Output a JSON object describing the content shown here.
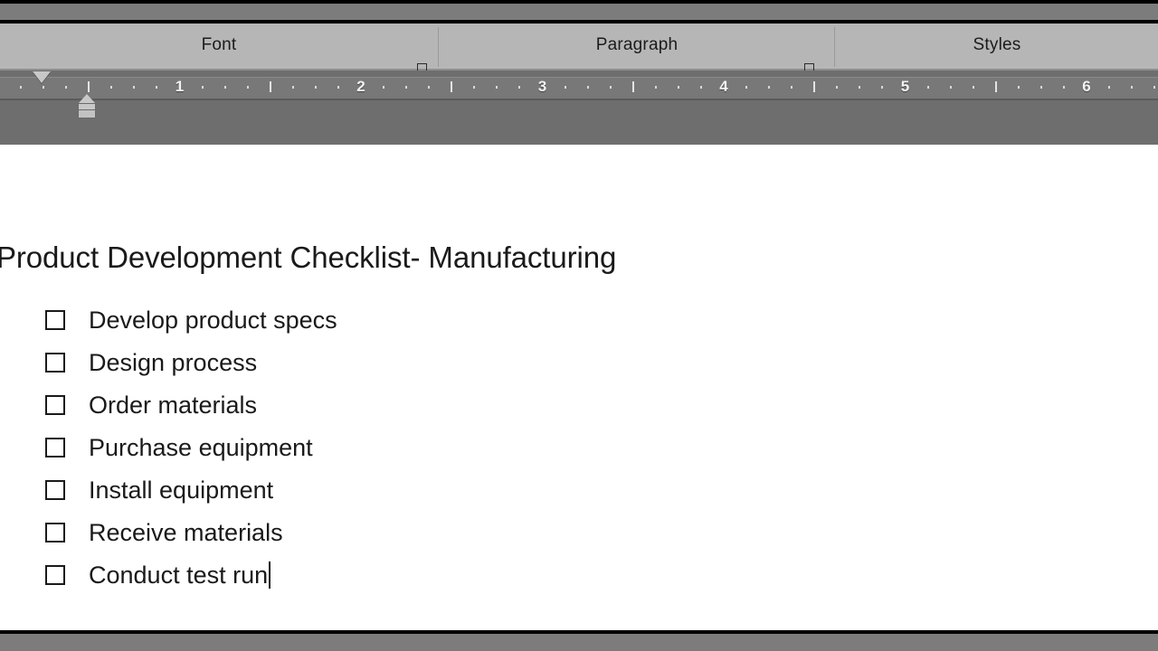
{
  "window": {
    "chrome_color": "#7c7c7c",
    "ribbon_color": "#b6b6b6",
    "ruler_color": "#787878",
    "page_color": "#ffffff",
    "text_color": "#1a1a1a"
  },
  "ribbon": {
    "groups": [
      {
        "label": "Font",
        "has_dialog_launcher": true
      },
      {
        "label": "Paragraph",
        "has_dialog_launcher": true
      },
      {
        "label": "Styles",
        "has_dialog_launcher": false
      }
    ]
  },
  "ruler": {
    "unit": "inch",
    "numbers": [
      "1",
      "2",
      "3",
      "4",
      "5",
      "6"
    ],
    "first_line_indent_inches": 0.0,
    "hanging_indent_inches": 0.25,
    "markers": {
      "first_line_indent": "first-line-indent-marker",
      "hanging_indent": "hanging-indent-marker"
    }
  },
  "document": {
    "title": "Product Development Checklist- Manufacturing",
    "checklist": [
      {
        "bullet": "empty-checkbox",
        "text": "Develop product specs"
      },
      {
        "bullet": "empty-checkbox",
        "text": "Design process"
      },
      {
        "bullet": "empty-checkbox",
        "text": "Order materials"
      },
      {
        "bullet": "empty-checkbox",
        "text": "Purchase equipment"
      },
      {
        "bullet": "empty-checkbox",
        "text": "Install equipment"
      },
      {
        "bullet": "empty-checkbox",
        "text": "Receive materials"
      },
      {
        "bullet": "empty-checkbox",
        "text": "Conduct test run"
      }
    ],
    "caret_after_item_index": 6
  }
}
